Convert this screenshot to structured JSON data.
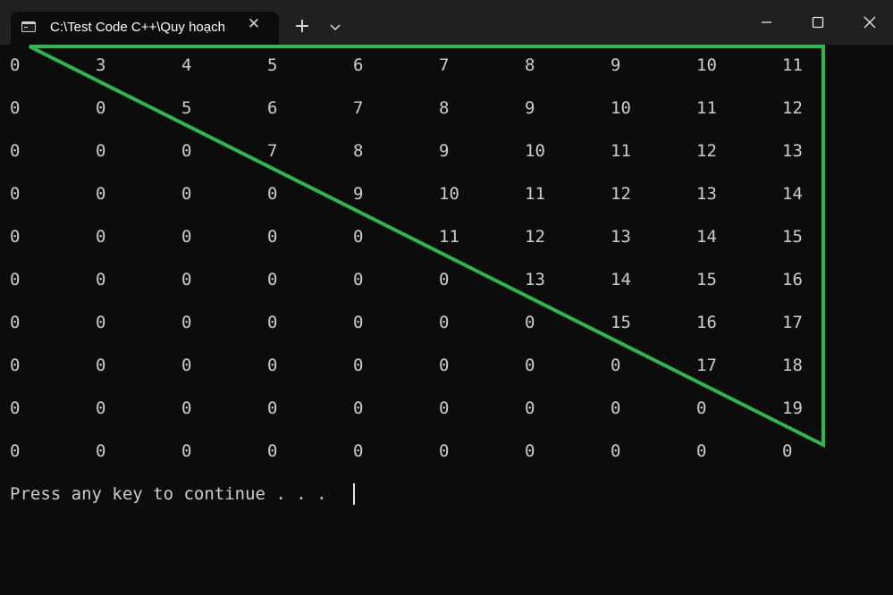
{
  "window": {
    "tab_title": "C:\\Test Code C++\\Quy hoạch",
    "tab_close_glyph": "✕",
    "new_tab_glyph": "+",
    "icons": {
      "tab": "terminal-icon",
      "close": "close-icon",
      "new_tab": "plus-icon",
      "dropdown": "chevron-down-icon",
      "minimize": "minimize-icon",
      "maximize": "maximize-icon",
      "window_close": "close-icon"
    }
  },
  "console": {
    "matrix": [
      [
        "0",
        "3",
        "4",
        "5",
        "6",
        "7",
        "8",
        "9",
        "10",
        "11"
      ],
      [
        "0",
        "0",
        "5",
        "6",
        "7",
        "8",
        "9",
        "10",
        "11",
        "12"
      ],
      [
        "0",
        "0",
        "0",
        "7",
        "8",
        "9",
        "10",
        "11",
        "12",
        "13"
      ],
      [
        "0",
        "0",
        "0",
        "0",
        "9",
        "10",
        "11",
        "12",
        "13",
        "14"
      ],
      [
        "0",
        "0",
        "0",
        "0",
        "0",
        "11",
        "12",
        "13",
        "14",
        "15"
      ],
      [
        "0",
        "0",
        "0",
        "0",
        "0",
        "0",
        "13",
        "14",
        "15",
        "16"
      ],
      [
        "0",
        "0",
        "0",
        "0",
        "0",
        "0",
        "0",
        "15",
        "16",
        "17"
      ],
      [
        "0",
        "0",
        "0",
        "0",
        "0",
        "0",
        "0",
        "0",
        "17",
        "18"
      ],
      [
        "0",
        "0",
        "0",
        "0",
        "0",
        "0",
        "0",
        "0",
        "0",
        "19"
      ],
      [
        "0",
        "0",
        "0",
        "0",
        "0",
        "0",
        "0",
        "0",
        "0",
        "0"
      ]
    ],
    "prompt_text": "Press any key to continue . . ."
  },
  "colors": {
    "background": "#0c0c0c",
    "titlebar": "#202020",
    "text": "#cccccc",
    "annotation": "#2db84d"
  }
}
